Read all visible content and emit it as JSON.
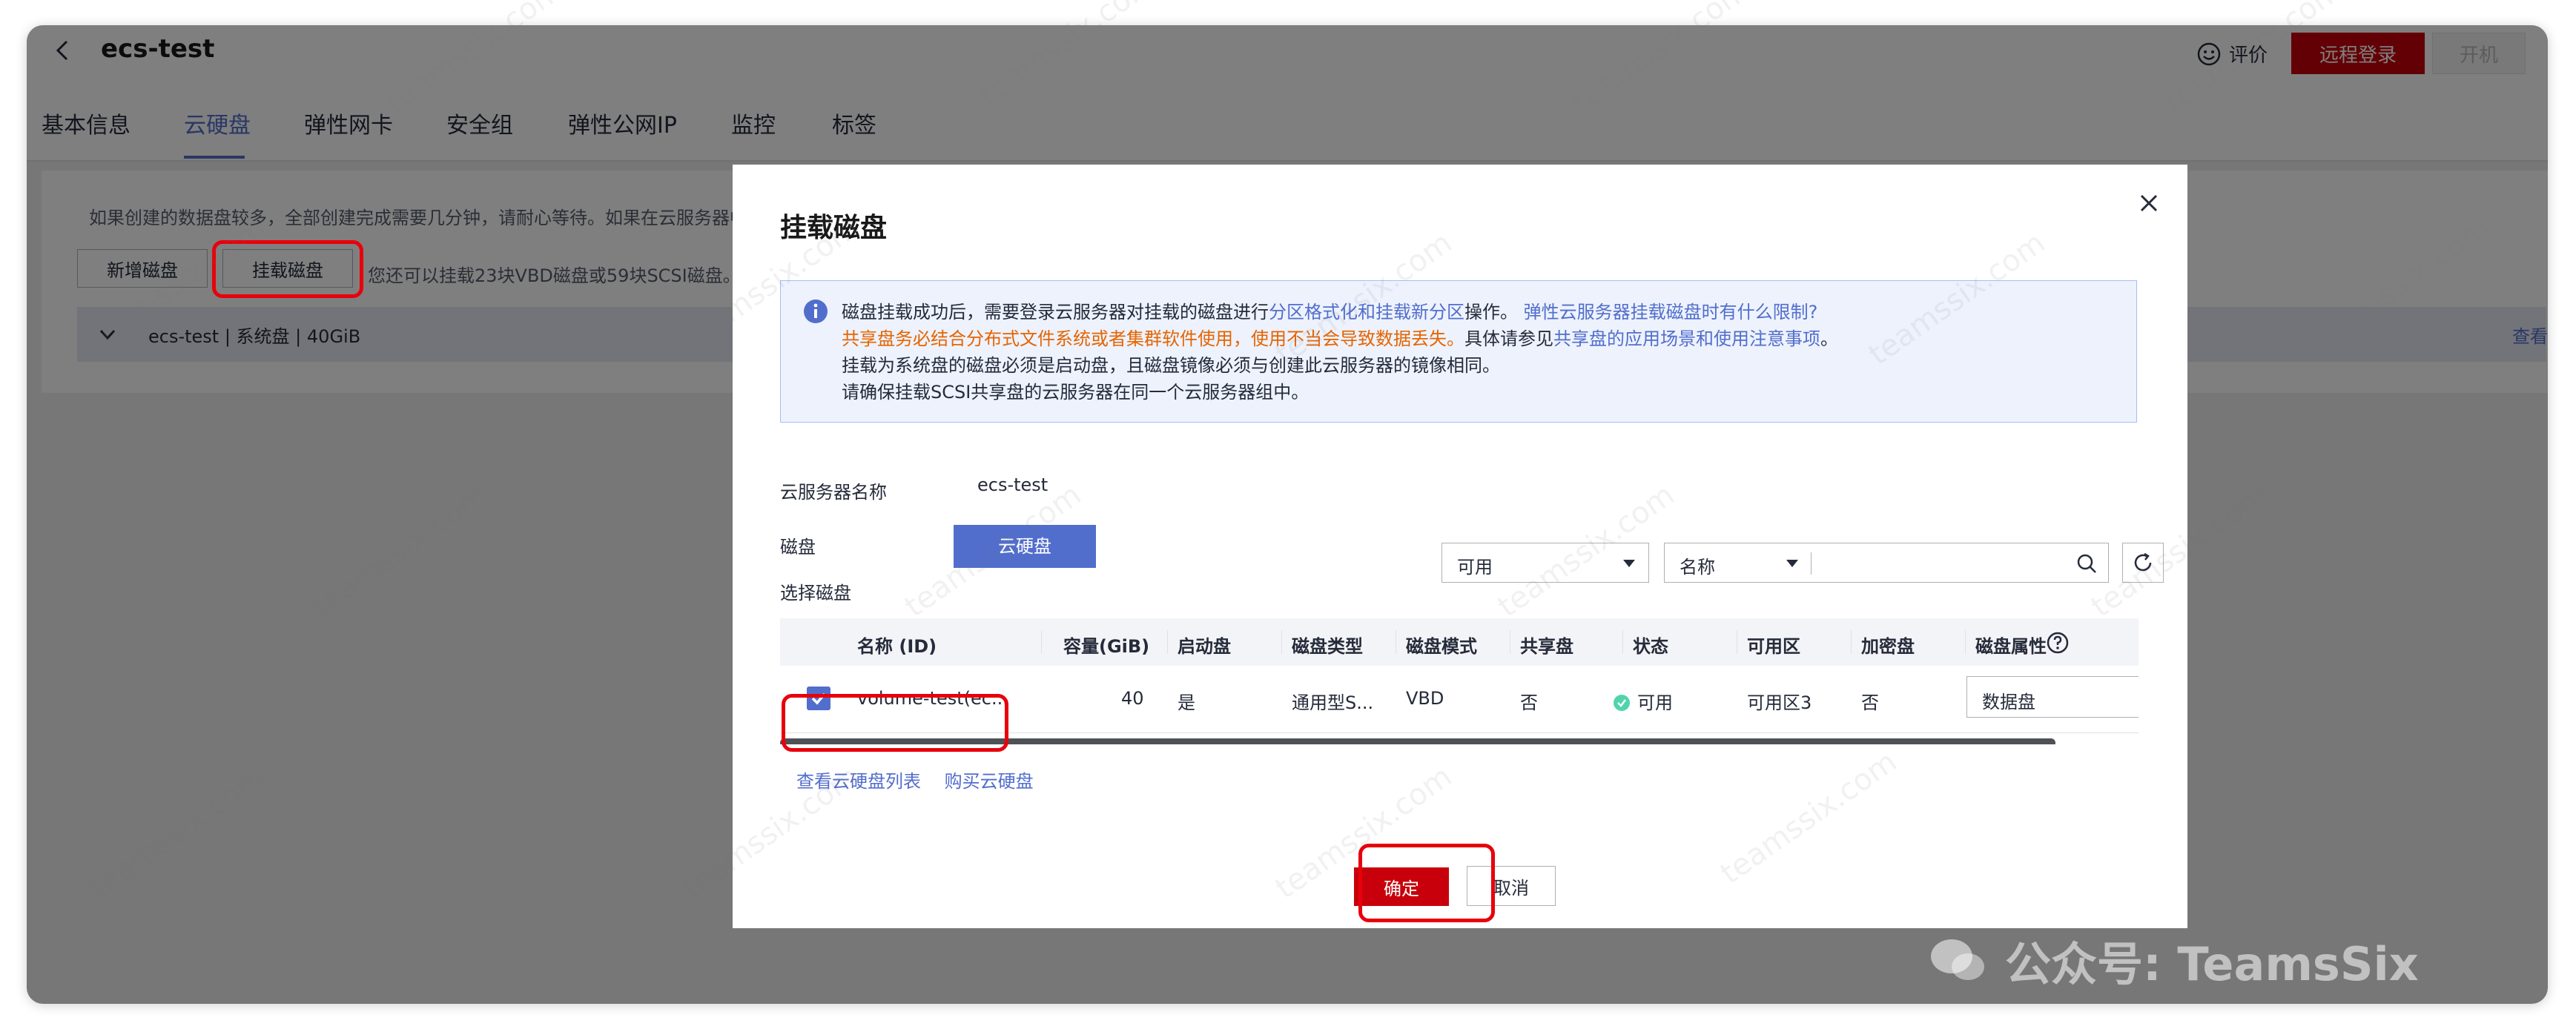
{
  "header": {
    "title": "ecs-test",
    "rate_label": "评价",
    "remote_login_label": "远程登录",
    "power_on_label": "开机"
  },
  "tabs": [
    {
      "label": "基本信息"
    },
    {
      "label": "云硬盘"
    },
    {
      "label": "弹性网卡"
    },
    {
      "label": "安全组"
    },
    {
      "label": "弹性公网IP"
    },
    {
      "label": "监控"
    },
    {
      "label": "标签"
    }
  ],
  "page": {
    "info_text": "如果创建的数据盘较多，全部创建完成需要几分钟，请耐心等待。如果在云服务器中",
    "add_disk_label": "新增磁盘",
    "attach_disk_label": "挂载磁盘",
    "quota_hint": "您还可以挂载23块VBD磁盘或59块SCSI磁盘。",
    "disk_row_text": "ecs-test | 系统盘 | 40GiB",
    "view_link": "查看"
  },
  "dialog": {
    "title": "挂载磁盘",
    "alert": {
      "l1_a": "磁盘挂载成功后，需要登录云服务器对挂载的磁盘进行",
      "l1_link1": "分区格式化和挂载新分区",
      "l1_b": "操作。",
      "l1_link2": "弹性云服务器挂载磁盘时有什么限制?",
      "l2_orange": "共享盘务必结合分布式文件系统或者集群软件使用，使用不当会导致数据丢失。",
      "l2_b": "具体请参见",
      "l2_link": "共享盘的应用场景和使用注意事项",
      "l2_c": "。",
      "l3": "挂载为系统盘的磁盘必须是启动盘，且磁盘镜像必须与创建此云服务器的镜像相同。",
      "l4": "请确保挂载SCSI共享盘的云服务器在同一个云服务器组中。"
    },
    "server_name_label": "云服务器名称",
    "server_name_value": "ecs-test",
    "disk_label": "磁盘",
    "disk_tag": "云硬盘",
    "select_disk_label": "选择磁盘",
    "filter_status": "可用",
    "filter_field": "名称",
    "search_placeholder": "",
    "table": {
      "headers": [
        "名称 (ID)",
        "容量(GiB)",
        "启动盘",
        "磁盘类型",
        "磁盘模式",
        "共享盘",
        "状态",
        "可用区",
        "加密盘",
        "磁盘属性"
      ],
      "row": {
        "name": "volume-test(ec...",
        "capacity": "40",
        "bootable": "是",
        "type": "通用型S...",
        "mode": "VBD",
        "shared": "否",
        "status": "可用",
        "zone": "可用区3",
        "encrypted": "否",
        "attribute": "数据盘"
      }
    },
    "link_list": "查看云硬盘列表",
    "link_buy": "购买云硬盘",
    "ok_label": "确定",
    "cancel_label": "取消"
  },
  "watermark": {
    "text": "teamssix.com",
    "wechat": "公众号: TeamsSix"
  },
  "colors": {
    "primary": "#526ecc",
    "danger": "#c7000b",
    "highlight": "#e8000b",
    "warning": "#e66400",
    "success": "#50d4ab"
  }
}
